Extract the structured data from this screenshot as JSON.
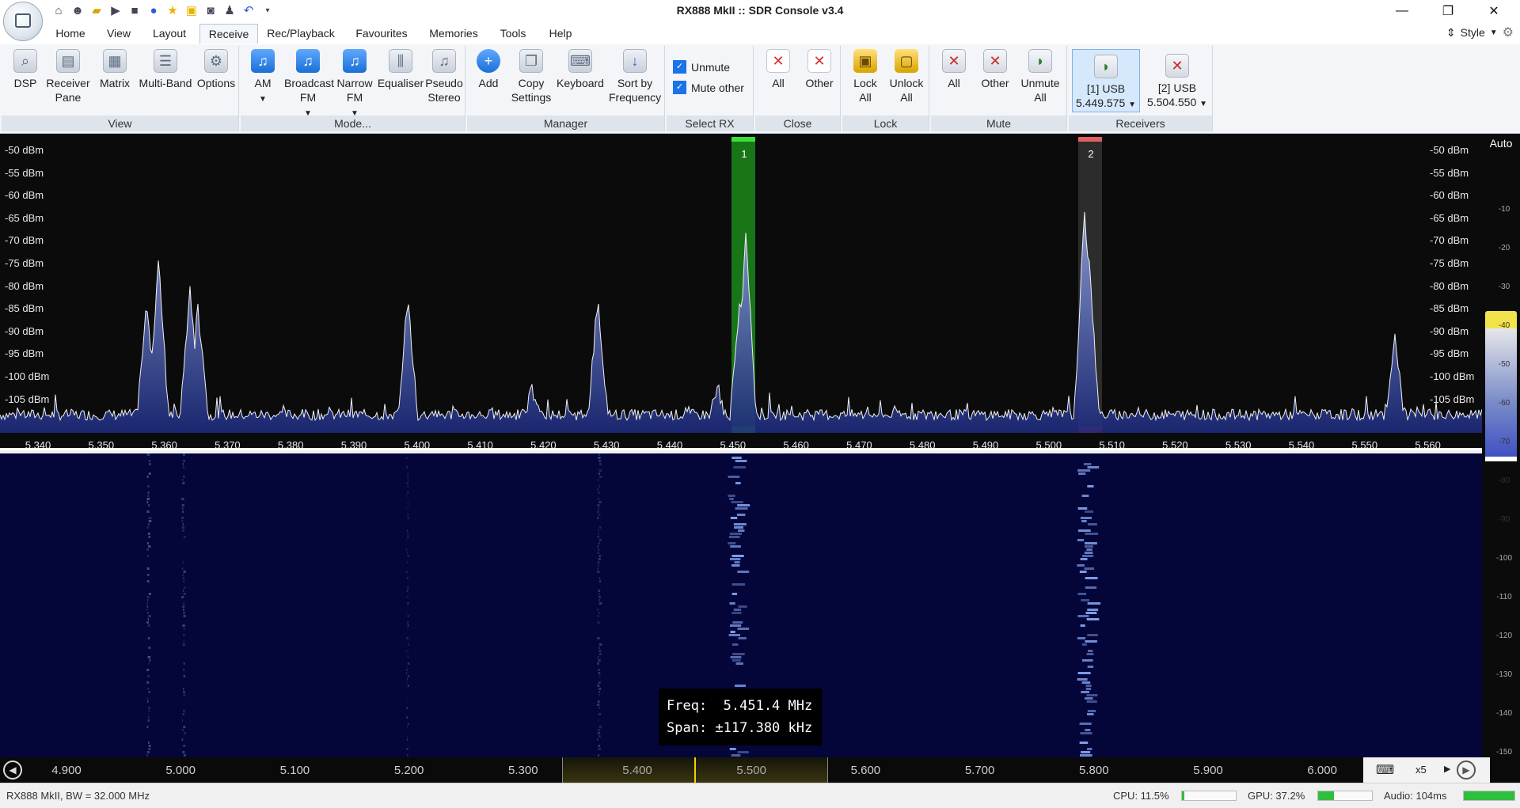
{
  "window": {
    "title": "RX888 MkII :: SDR Console v3.4",
    "controls": {
      "minimize": "—",
      "restore": "❐",
      "close": "✕"
    }
  },
  "qat_icons": [
    "home-icon",
    "people-icon",
    "folder-icon",
    "play-icon",
    "stop-icon",
    "record-icon",
    "star-icon",
    "lock-icon",
    "camera-icon",
    "user-icon",
    "undo-icon",
    "dropdown-icon"
  ],
  "menu": {
    "tabs": [
      "Home",
      "View",
      "Layout",
      "Receive",
      "Rec/Playback",
      "Favourites",
      "Memories",
      "Tools",
      "Help"
    ],
    "active": "Receive",
    "style_label": "Style"
  },
  "ribbon": {
    "view": {
      "label": "View",
      "buttons": [
        "DSP",
        "Receiver Pane",
        "Matrix",
        "Multi-Band",
        "Options"
      ]
    },
    "mode": {
      "label": "Mode...",
      "buttons": [
        "AM",
        "Broadcast FM",
        "Narrow FM",
        "Equaliser",
        "Pseudo Stereo"
      ]
    },
    "manager": {
      "label": "Manager",
      "buttons": [
        "Add",
        "Copy Settings",
        "Keyboard",
        "Sort by Frequency"
      ]
    },
    "select_rx": {
      "label": "Select RX",
      "unmute": "Unmute",
      "mute_other": "Mute other",
      "unmute_checked": true,
      "mute_other_checked": true
    },
    "close": {
      "label": "Close",
      "buttons": [
        "All",
        "Other"
      ]
    },
    "lock": {
      "label": "Lock",
      "buttons": [
        "Lock All",
        "Unlock All"
      ]
    },
    "mute": {
      "label": "Mute",
      "buttons": [
        "All",
        "Other",
        "Unmute All"
      ]
    },
    "receivers": {
      "label": "Receivers",
      "items": [
        {
          "id": "[1]",
          "mode": "USB",
          "freq": "5.449.575"
        },
        {
          "id": "[2]",
          "mode": "USB",
          "freq": "5.504.550"
        }
      ]
    }
  },
  "spectrum": {
    "db_labels": [
      "-50 dBm",
      "-55 dBm",
      "-60 dBm",
      "-65 dBm",
      "-70 dBm",
      "-75 dBm",
      "-80 dBm",
      "-85 dBm",
      "-90 dBm",
      "-95 dBm",
      "-100 dBm",
      "-105 dBm"
    ],
    "freq_labels": [
      "5.340",
      "5.350",
      "5.360",
      "5.370",
      "5.380",
      "5.390",
      "5.400",
      "5.410",
      "5.420",
      "5.430",
      "5.440",
      "5.450",
      "5.460",
      "5.470",
      "5.480",
      "5.490",
      "5.500",
      "5.510",
      "5.520",
      "5.530",
      "5.540",
      "5.550",
      "5.560"
    ],
    "receiver_markers": [
      {
        "label": "1",
        "color": "#1aa51a"
      },
      {
        "label": "2",
        "color": "#c23030"
      }
    ]
  },
  "scale": {
    "auto_label": "Auto",
    "ticks": [
      "-10",
      "-20",
      "-30",
      "-40",
      "-50",
      "-60",
      "-70",
      "-80",
      "-90",
      "-100",
      "-110",
      "-120",
      "-130",
      "-140",
      "-150"
    ]
  },
  "tooltip": {
    "freq_line": "Freq:  5.451.4 MHz",
    "span_line": "Span: ±117.380 kHz"
  },
  "bandbar": {
    "freqs": [
      "4.900",
      "5.000",
      "5.100",
      "5.200",
      "5.300",
      "5.400",
      "5.500",
      "5.600",
      "5.700",
      "5.800",
      "5.900",
      "6.000"
    ],
    "zoom": "x5"
  },
  "status": {
    "device": "RX888 MkII, BW = 32.000 MHz",
    "cpu": "CPU: 11.5%",
    "cpu_level": 0.05,
    "gpu": "GPU: 37.2%",
    "gpu_level": 0.3,
    "audio": "Audio: 104ms",
    "audio_level": 1.0
  }
}
